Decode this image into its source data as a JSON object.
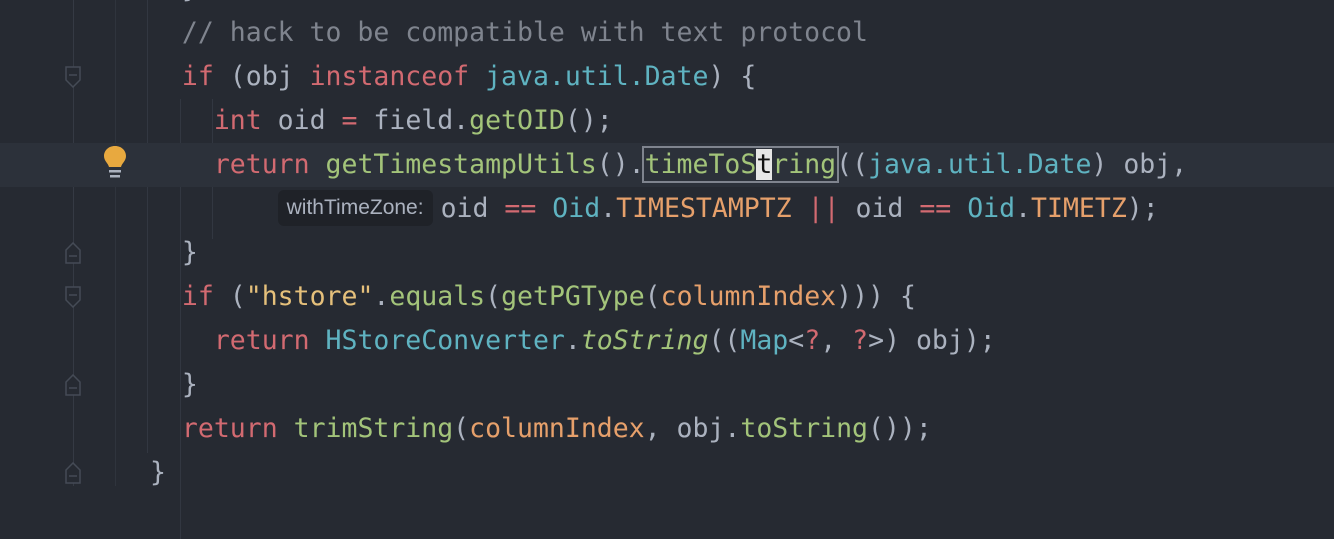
{
  "editor": {
    "current_line": 4,
    "inlay_hint": "withTimeZone:",
    "lines": [
      {
        "indent": 2,
        "tokens": [
          [
            "}",
            "pl"
          ]
        ]
      },
      {
        "indent": 2,
        "tokens": [
          [
            "// hack to be compatible with text protocol",
            "cm"
          ]
        ]
      },
      {
        "indent": 2,
        "tokens": [
          [
            "if",
            "kw"
          ],
          [
            " (obj ",
            "pl"
          ],
          [
            "instanceof",
            "kw"
          ],
          [
            " ",
            "pl"
          ],
          [
            "java.util.Date",
            "ty"
          ],
          [
            ") {",
            "pl"
          ]
        ]
      },
      {
        "indent": 4,
        "tokens": [
          [
            "int",
            "kw"
          ],
          [
            " oid ",
            "pl"
          ],
          [
            "=",
            "kw"
          ],
          [
            " field.",
            "pl"
          ],
          [
            "getOID",
            "fn"
          ],
          [
            "();",
            "pl"
          ]
        ]
      },
      {
        "indent": 4,
        "tokens": [
          [
            "return",
            "kw"
          ],
          [
            " ",
            "pl"
          ],
          [
            "getTimestampUtils",
            "fn"
          ],
          [
            "().",
            "pl"
          ],
          [
            "timeToS",
            "fn hl-start"
          ],
          [
            "t",
            "caret"
          ],
          [
            "ring",
            "fn hl-end"
          ],
          [
            "((",
            "pl"
          ],
          [
            "java.util.Date",
            "ty"
          ],
          [
            ") obj,",
            "pl"
          ]
        ]
      },
      {
        "indent": 8,
        "inlay": true,
        "tokens": [
          [
            "oid ",
            "pl"
          ],
          [
            "==",
            "kw"
          ],
          [
            " ",
            "pl"
          ],
          [
            "Oid",
            "ty"
          ],
          [
            ".",
            "pl"
          ],
          [
            "TIMESTAMPTZ",
            "num"
          ],
          [
            " ",
            "pl"
          ],
          [
            "||",
            "kw"
          ],
          [
            " oid ",
            "pl"
          ],
          [
            "==",
            "kw"
          ],
          [
            " ",
            "pl"
          ],
          [
            "Oid",
            "ty"
          ],
          [
            ".",
            "pl"
          ],
          [
            "TIMETZ",
            "num"
          ],
          [
            ");",
            "pl"
          ]
        ]
      },
      {
        "indent": 2,
        "tokens": [
          [
            "}",
            "pl"
          ]
        ]
      },
      {
        "indent": 2,
        "tokens": [
          [
            "if",
            "kw"
          ],
          [
            " (",
            "pl"
          ],
          [
            "\"hstore\"",
            "str"
          ],
          [
            ".",
            "pl"
          ],
          [
            "equals",
            "fn"
          ],
          [
            "(",
            "pl"
          ],
          [
            "getPGType",
            "fn"
          ],
          [
            "(",
            "pl"
          ],
          [
            "columnIndex",
            "num"
          ],
          [
            ")))",
            "pl"
          ],
          [
            " {",
            "pl"
          ]
        ]
      },
      {
        "indent": 4,
        "tokens": [
          [
            "return",
            "kw"
          ],
          [
            " ",
            "pl"
          ],
          [
            "HStoreConverter",
            "ty"
          ],
          [
            ".",
            "pl"
          ],
          [
            "toString",
            "fn it"
          ],
          [
            "((",
            "pl"
          ],
          [
            "Map",
            "ty"
          ],
          [
            "<",
            "pl"
          ],
          [
            "?",
            "kw"
          ],
          [
            ", ",
            "pl"
          ],
          [
            "?",
            "kw"
          ],
          [
            ">",
            "pl"
          ],
          [
            ") obj);",
            "pl"
          ]
        ]
      },
      {
        "indent": 2,
        "tokens": [
          [
            "}",
            "pl"
          ]
        ]
      },
      {
        "indent": 2,
        "tokens": [
          [
            "return",
            "kw"
          ],
          [
            " ",
            "pl"
          ],
          [
            "trimString",
            "fn"
          ],
          [
            "(",
            "pl"
          ],
          [
            "columnIndex",
            "num"
          ],
          [
            ", obj.",
            "pl"
          ],
          [
            "toString",
            "fn"
          ],
          [
            "());",
            "pl"
          ]
        ]
      },
      {
        "indent": 0,
        "tokens": [
          [
            "}",
            "pl"
          ]
        ]
      }
    ]
  },
  "colors": {
    "background": "#262a32",
    "current_line": "#2c313a",
    "bulb": "#e8a93f"
  }
}
